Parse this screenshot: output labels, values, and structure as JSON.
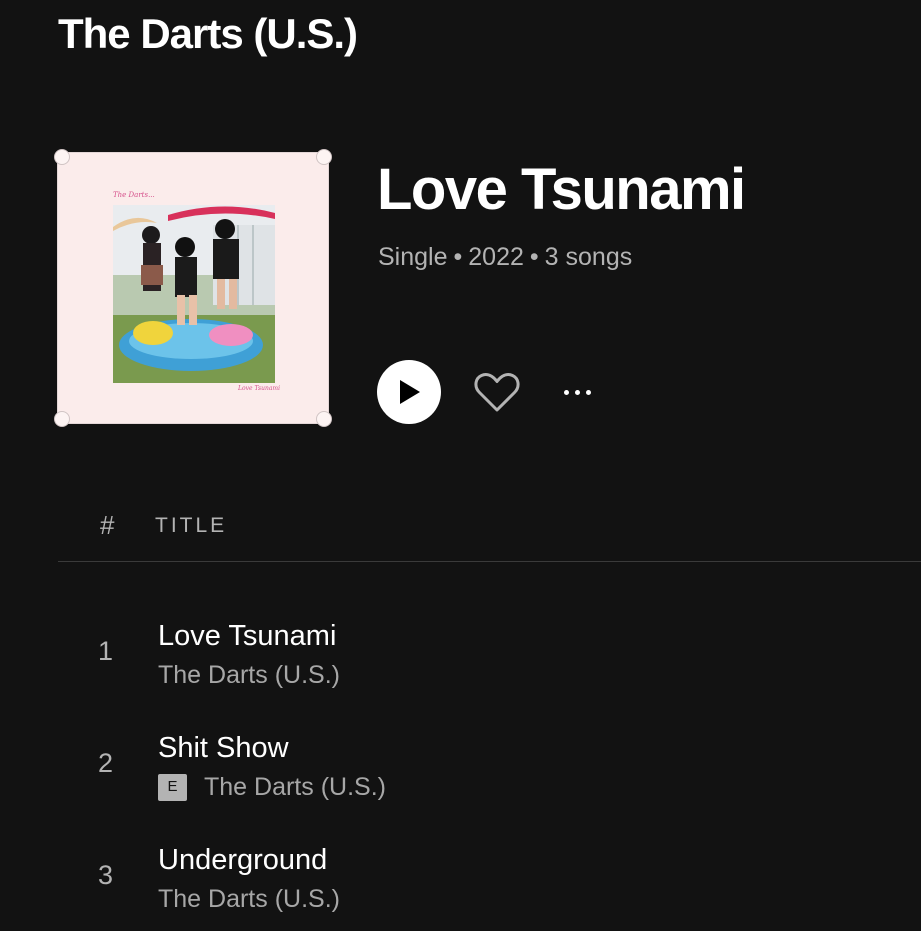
{
  "header": {
    "artist_title": "The Darts (U.S.)"
  },
  "album": {
    "title": "Love Tsunami",
    "type": "Single",
    "year": "2022",
    "song_count": "3 songs",
    "separator": "•",
    "cover": {
      "sig_top": "The Darts...",
      "sig_bottom": "Love Tsunami"
    }
  },
  "actions": {
    "play_icon": "play-icon",
    "heart_icon": "heart-icon",
    "more_icon": "more-options-icon"
  },
  "table": {
    "headers": {
      "number": "#",
      "title": "TITLE"
    },
    "tracks": [
      {
        "number": "1",
        "title": "Love Tsunami",
        "artist": "The Darts (U.S.)",
        "explicit": false
      },
      {
        "number": "2",
        "title": "Shit Show",
        "artist": "The Darts (U.S.)",
        "explicit": true,
        "explicit_label": "E"
      },
      {
        "number": "3",
        "title": "Underground",
        "artist": "The Darts (U.S.)",
        "explicit": false
      }
    ]
  },
  "colors": {
    "background": "#121212",
    "text_primary": "#ffffff",
    "text_secondary": "#b3b3b3",
    "divider": "#3a3a3a"
  }
}
